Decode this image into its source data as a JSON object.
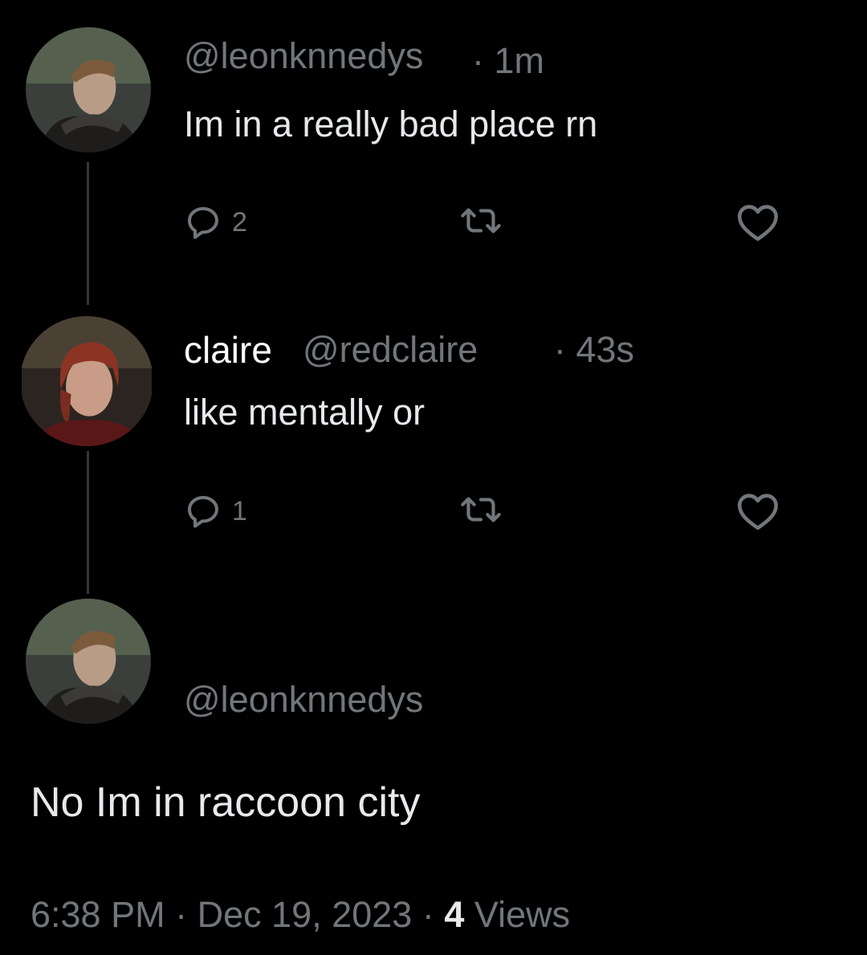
{
  "tweets": [
    {
      "handle": "@leonknnedys",
      "time": "· 1m",
      "text": "Im in a really bad place rn",
      "reply_count": "2",
      "avatar_icon": "leon-avatar"
    },
    {
      "display_name": "claire",
      "handle": "@redclaire",
      "time": "· 43s",
      "text": "like mentally or",
      "reply_count": "1",
      "avatar_icon": "claire-avatar"
    }
  ],
  "main_tweet": {
    "handle": "@leonknnedys",
    "text": "No Im in raccoon city",
    "time": "6:38 PM",
    "separator": "·",
    "date": "Dec 19, 2023",
    "views_count": "4",
    "views_label": "Views",
    "avatar_icon": "leon-avatar"
  },
  "icons": {
    "reply": "speech-bubble-icon",
    "retweet": "retweet-arrows-icon",
    "like": "heart-outline-icon"
  },
  "colors": {
    "background": "#000000",
    "text_primary": "#e7e9ea",
    "text_secondary": "#71767b",
    "thread_line": "#333639"
  }
}
